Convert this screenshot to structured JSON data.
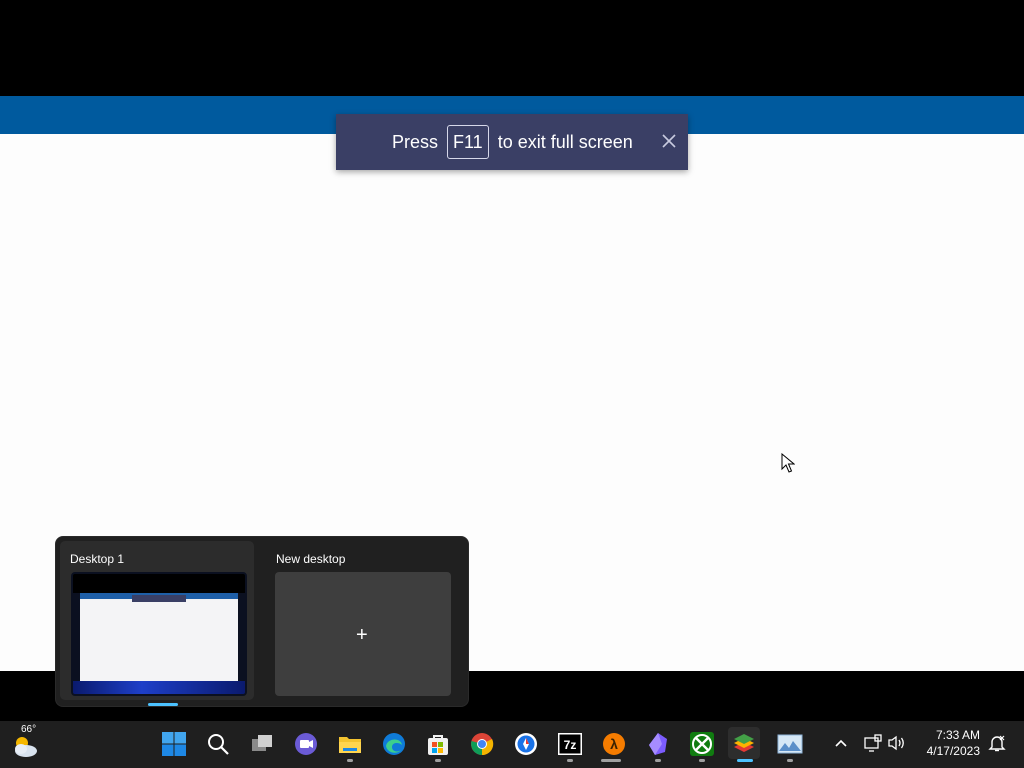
{
  "toast": {
    "press": "Press",
    "key": "F11",
    "rest": "to exit full screen"
  },
  "desktops": [
    {
      "label": "Desktop 1"
    },
    {
      "label": "New desktop"
    }
  ],
  "new_desktop_symbol": "+",
  "taskbar": {
    "weather_temp": "66°",
    "icons": [
      "windows-start-icon",
      "search-icon",
      "task-view-icon",
      "chat-icon",
      "file-explorer-icon",
      "edge-icon",
      "store-icon",
      "chrome-icon",
      "brave-icon",
      "7zip-icon",
      "half-life-icon",
      "obsidian-icon",
      "xbox-icon",
      "bluestacks-icon",
      "desktop-wallpaper-icon"
    ],
    "time": "7:33 AM",
    "date": "4/17/2023"
  },
  "colors": {
    "accent": "#4cc2ff",
    "band_blue": "#005a9e",
    "toast_bg": "#3a3f65"
  }
}
